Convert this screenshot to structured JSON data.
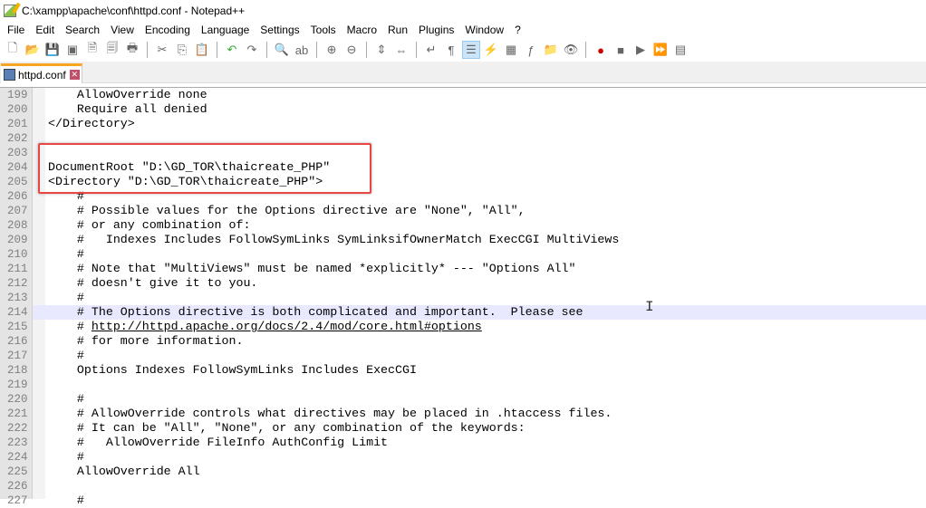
{
  "window": {
    "title": "C:\\xampp\\apache\\conf\\httpd.conf - Notepad++"
  },
  "menu": [
    "File",
    "Edit",
    "Search",
    "View",
    "Encoding",
    "Language",
    "Settings",
    "Tools",
    "Macro",
    "Run",
    "Plugins",
    "Window",
    "?"
  ],
  "toolbar": [
    "new-file-icon",
    "open-icon",
    "save-icon",
    "save-all-icon",
    "close-icon",
    "close-all-icon",
    "print-icon",
    "|",
    "cut-icon",
    "copy-icon",
    "paste-icon",
    "|",
    "undo-icon",
    "redo-icon",
    "|",
    "find-icon",
    "replace-icon",
    "|",
    "zoom-in-icon",
    "zoom-out-icon",
    "|",
    "sync-v-icon",
    "sync-h-icon",
    "|",
    "word-wrap-icon",
    "show-all-chars-icon",
    "indent-guide-icon",
    "udl-icon",
    "doc-map-icon",
    "function-list-icon",
    "folder-workspace-icon",
    "monitoring-icon",
    "|",
    "record-macro-icon",
    "stop-macro-icon",
    "play-macro-icon",
    "run-macro-multiple-icon",
    "save-macro-icon"
  ],
  "tab": {
    "label": "httpd.conf"
  },
  "editor": {
    "current_line": 214,
    "lines": [
      {
        "n": "199",
        "text": "    AllowOverride none"
      },
      {
        "n": "200",
        "text": "    Require all denied"
      },
      {
        "n": "201",
        "text": "</Directory>"
      },
      {
        "n": "202",
        "text": ""
      },
      {
        "n": "203",
        "text": ""
      },
      {
        "n": "204",
        "text": "DocumentRoot \"D:\\GD_TOR\\thaicreate_PHP\""
      },
      {
        "n": "205",
        "text": "<Directory \"D:\\GD_TOR\\thaicreate_PHP\">"
      },
      {
        "n": "206",
        "text": "    #"
      },
      {
        "n": "207",
        "text": "    # Possible values for the Options directive are \"None\", \"All\","
      },
      {
        "n": "208",
        "text": "    # or any combination of:"
      },
      {
        "n": "209",
        "text": "    #   Indexes Includes FollowSymLinks SymLinksifOwnerMatch ExecCGI MultiViews"
      },
      {
        "n": "210",
        "text": "    #"
      },
      {
        "n": "211",
        "text": "    # Note that \"MultiViews\" must be named *explicitly* --- \"Options All\""
      },
      {
        "n": "212",
        "text": "    # doesn't give it to you."
      },
      {
        "n": "213",
        "text": "    #"
      },
      {
        "n": "214",
        "text": "    # The Options directive is both complicated and important.  Please see"
      },
      {
        "n": "215",
        "text": "    # ",
        "link": "http://httpd.apache.org/docs/2.4/mod/core.html#options"
      },
      {
        "n": "216",
        "text": "    # for more information."
      },
      {
        "n": "217",
        "text": "    #"
      },
      {
        "n": "218",
        "text": "    Options Indexes FollowSymLinks Includes ExecCGI"
      },
      {
        "n": "219",
        "text": ""
      },
      {
        "n": "220",
        "text": "    #"
      },
      {
        "n": "221",
        "text": "    # AllowOverride controls what directives may be placed in .htaccess files."
      },
      {
        "n": "222",
        "text": "    # It can be \"All\", \"None\", or any combination of the keywords:"
      },
      {
        "n": "223",
        "text": "    #   AllowOverride FileInfo AuthConfig Limit"
      },
      {
        "n": "224",
        "text": "    #"
      },
      {
        "n": "225",
        "text": "    AllowOverride All"
      },
      {
        "n": "226",
        "text": ""
      },
      {
        "n": "227",
        "text": "    #"
      }
    ]
  },
  "colors": {
    "annotation_box": "#e84545",
    "current_line": "#e8e8ff",
    "tab_accent": "#f6a623"
  }
}
